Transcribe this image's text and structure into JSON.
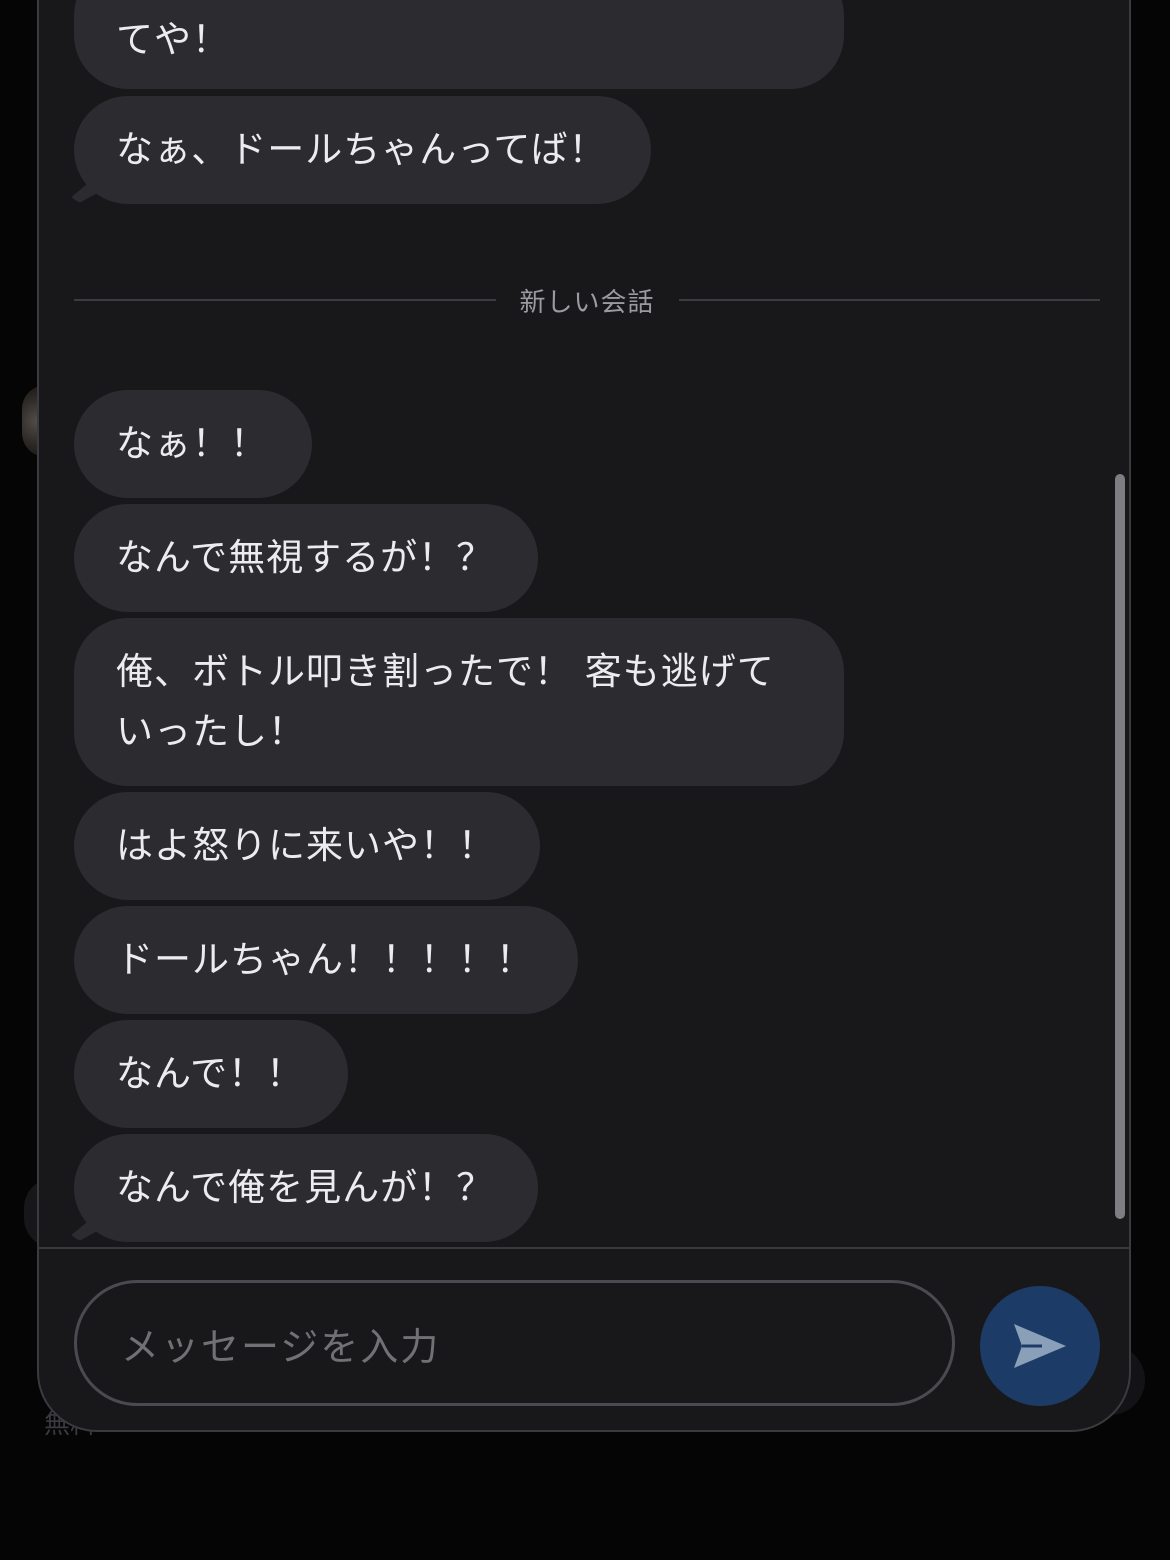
{
  "background": {
    "partial_text": "無料"
  },
  "messages_before": [
    {
      "text": "てや！"
    },
    {
      "text": "なぁ、ドールちゃんってば！"
    }
  ],
  "divider": {
    "label": "新しい会話"
  },
  "messages_after": [
    {
      "text": "なぁ！！"
    },
    {
      "text": "なんで無視するが！？"
    },
    {
      "text": "俺、ボトル叩き割ったで！ 客も逃げていったし！"
    },
    {
      "text": "はよ怒りに来いや！！"
    },
    {
      "text": "ドールちゃん！！！！！"
    },
    {
      "text": "なんで！！"
    },
    {
      "text": "なんで俺を見んが！？"
    }
  ],
  "composer": {
    "placeholder": "メッセージを入力",
    "send_icon": "send-icon"
  },
  "colors": {
    "panel": "#18181b",
    "bubble": "#2c2c30",
    "send_button": "#1c3b66",
    "send_icon": "#8aa0b8"
  }
}
